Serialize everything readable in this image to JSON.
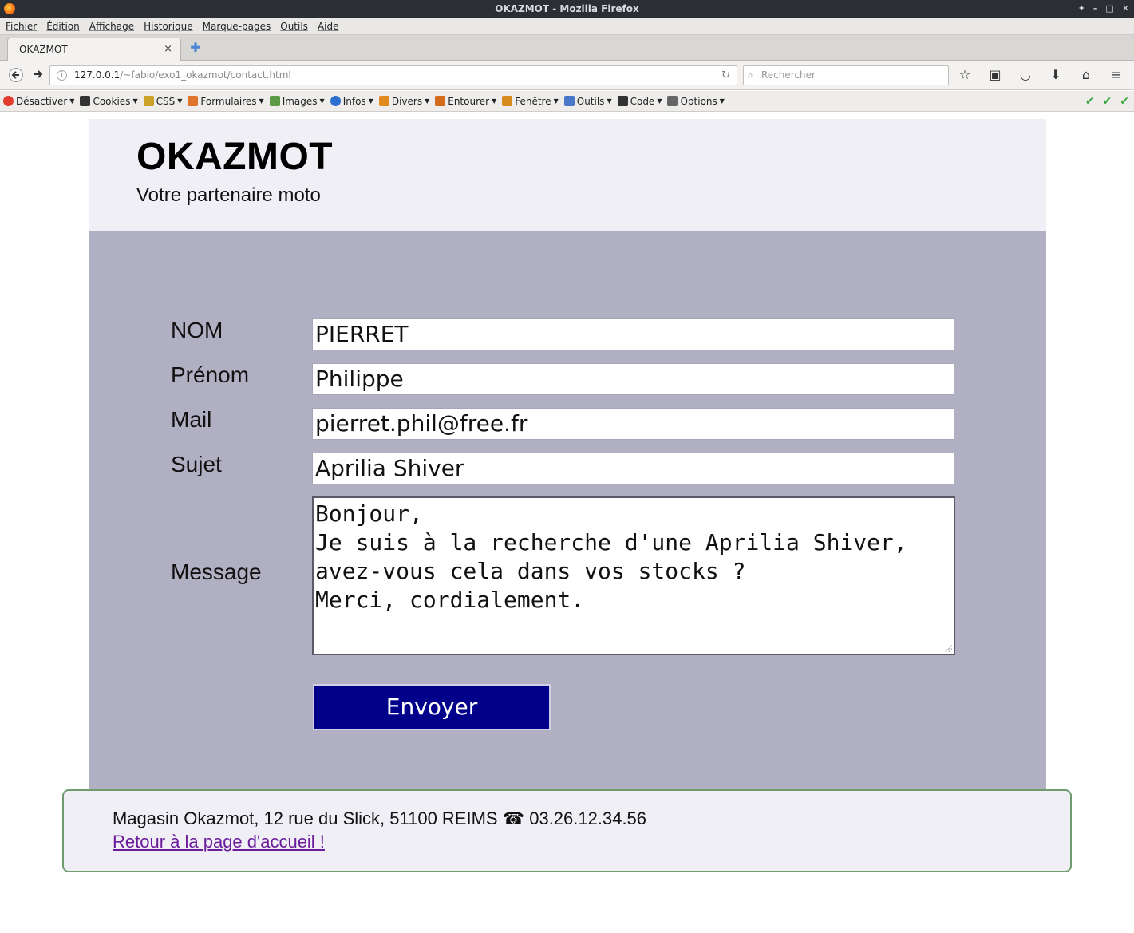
{
  "window": {
    "title": "OKAZMOT - Mozilla Firefox",
    "controls": [
      "✦",
      "–",
      "□",
      "✕"
    ]
  },
  "menubar": [
    "Fichier",
    "Édition",
    "Affichage",
    "Historique",
    "Marque-pages",
    "Outils",
    "Aide"
  ],
  "tab": {
    "title": "OKAZMOT",
    "close": "×",
    "new_tab": "✚"
  },
  "navbar": {
    "url_host": "127.0.0.1",
    "url_path": "/~fabio/exo1_okazmot/contact.html",
    "search_placeholder": "Rechercher",
    "icons": [
      "star-icon",
      "clipboard-icon",
      "pocket-icon",
      "download-icon",
      "home-icon",
      "menu-icon"
    ]
  },
  "devbar": {
    "items": [
      {
        "label": "Désactiver",
        "icon": "disable-icon",
        "color": "#e23b2e"
      },
      {
        "label": "Cookies",
        "icon": "cookie-icon",
        "color": "#333333"
      },
      {
        "label": "CSS",
        "icon": "css-icon",
        "color": "#c9a227"
      },
      {
        "label": "Formulaires",
        "icon": "forms-icon",
        "color": "#e0742a"
      },
      {
        "label": "Images",
        "icon": "images-icon",
        "color": "#5b9a47"
      },
      {
        "label": "Infos",
        "icon": "info-icon",
        "color": "#2c6fd1"
      },
      {
        "label": "Divers",
        "icon": "misc-icon",
        "color": "#e08a1e"
      },
      {
        "label": "Entourer",
        "icon": "outline-icon",
        "color": "#d46a1c"
      },
      {
        "label": "Fenêtre",
        "icon": "resize-icon",
        "color": "#d98a1c"
      },
      {
        "label": "Outils",
        "icon": "tools-icon",
        "color": "#4a78c9"
      },
      {
        "label": "Code",
        "icon": "code-icon",
        "color": "#333333"
      },
      {
        "label": "Options",
        "icon": "options-icon",
        "color": "#666666"
      }
    ]
  },
  "page": {
    "brand": "OKAZMOT",
    "tagline": "Votre partenaire moto",
    "colors": {
      "header_bg": "#f0eff5",
      "form_bg": "#b1b0c3",
      "button_bg": "#00008b",
      "footer_border": "#6f9c6f",
      "link": "#6a1b9a"
    },
    "form": {
      "nom": {
        "label": "NOM",
        "value": "PIERRET"
      },
      "prenom": {
        "label": "Prénom",
        "value": "Philippe"
      },
      "mail": {
        "label": "Mail",
        "value": "pierret.phil@free.fr"
      },
      "sujet": {
        "label": "Sujet",
        "value": "Aprilia Shiver"
      },
      "message": {
        "label": "Message",
        "value": "Bonjour,\nJe suis à la recherche d'une Aprilia Shiver, avez-vous cela dans vos stocks ?\nMerci, cordialement."
      },
      "submit_label": "Envoyer"
    },
    "footer": {
      "address": "Magasin Okazmot, 12 rue du Slick, 51100 REIMS ☎ 03.26.12.34.56",
      "home_link": "Retour à la page d'accueil !"
    }
  }
}
